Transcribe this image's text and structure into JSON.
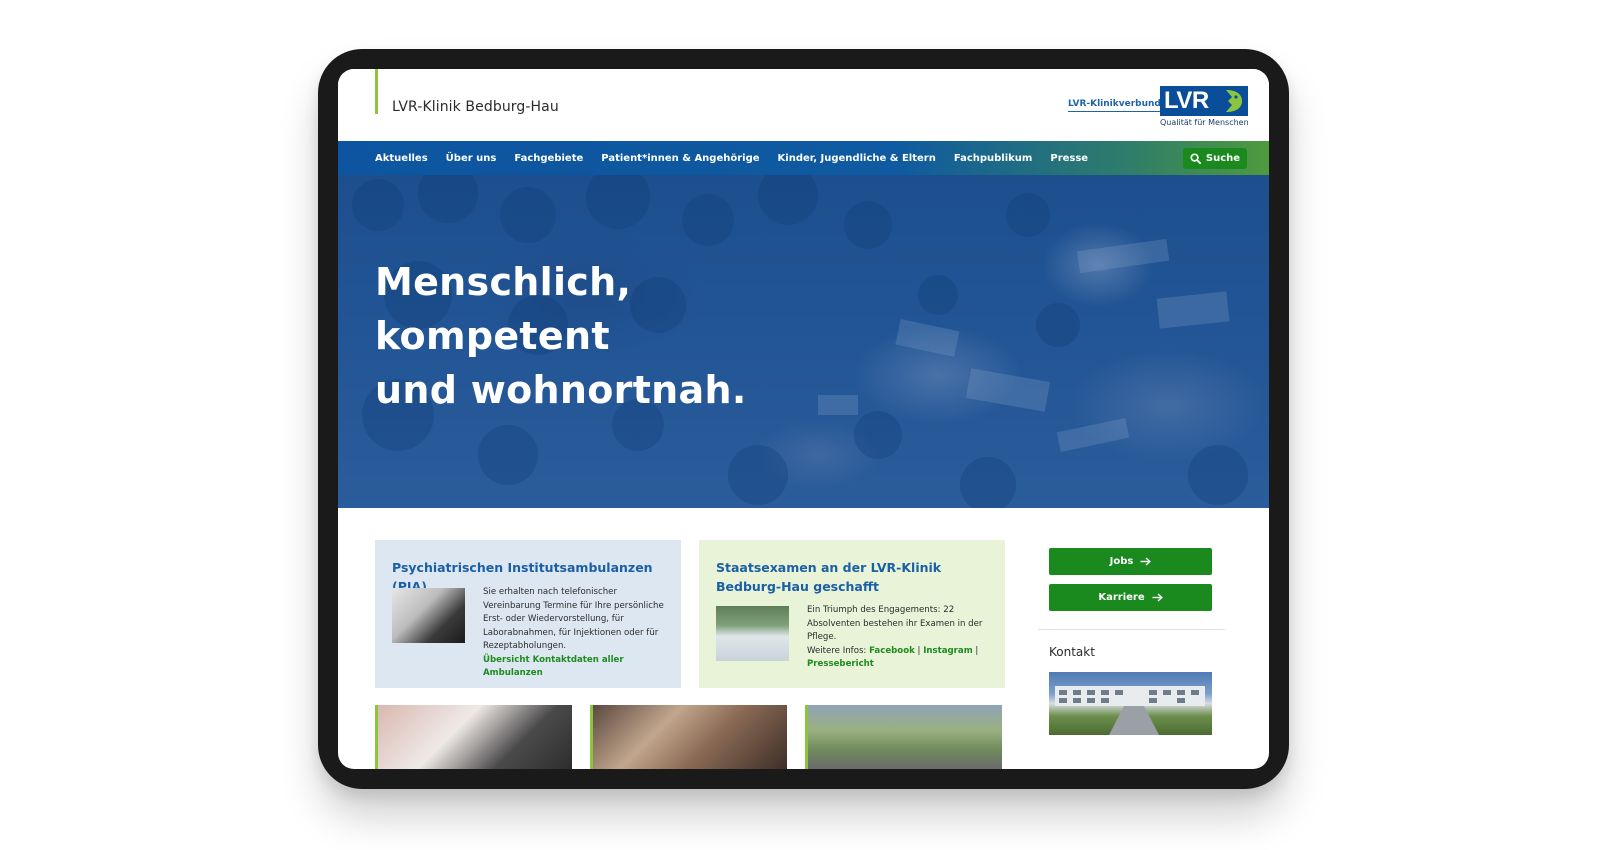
{
  "header": {
    "site_title": "LVR-Klinik Bedburg-Hau",
    "klinikverbund_link": "LVR-Klinikverbund",
    "logo_text": "LVR",
    "logo_tagline": "Qualität für Menschen"
  },
  "nav": {
    "items": [
      {
        "label": "Aktuelles"
      },
      {
        "label": "Über uns"
      },
      {
        "label": "Fachgebiete"
      },
      {
        "label": "Patient*innen & Angehörige"
      },
      {
        "label": "Kinder, Jugendliche & Eltern"
      },
      {
        "label": "Fachpublikum"
      },
      {
        "label": "Presse"
      }
    ],
    "search_label": "Suche"
  },
  "hero": {
    "line1": "Menschlich,",
    "line2": "kompetent",
    "line3": "und wohnortnah."
  },
  "cards": {
    "pia": {
      "title": "Psychiatrischen Institutsambulanzen (PIA)",
      "body": "Sie erhalten nach telefonischer Vereinbarung Termine für Ihre persönliche Erst- oder Wiedervorstellung, für Laborabnahmen, für Injektionen oder für Rezeptabholungen.",
      "link": "Übersicht Kontaktdaten aller Ambulanzen"
    },
    "staatsexamen": {
      "title": "Staatsexamen an der LVR-Klinik Bedburg-Hau geschafft",
      "body": "Ein Triumph des Engagements: 22 Absolventen bestehen ihr Examen in der Pflege.",
      "more_prefix": "Weitere Infos: ",
      "link_facebook": "Facebook",
      "separator": " | ",
      "link_instagram": "Instagram",
      "link_pressebericht": "Pressebericht"
    }
  },
  "sidebar": {
    "jobs_label": "Jobs",
    "karriere_label": "Karriere",
    "kontakt_heading": "Kontakt"
  },
  "colors": {
    "nav_blue": "#0d55a0",
    "nav_green": "#4f9a3e",
    "button_green": "#1a8a1e",
    "accent_lime": "#8cc63f",
    "title_blue": "#1b5fa6"
  }
}
